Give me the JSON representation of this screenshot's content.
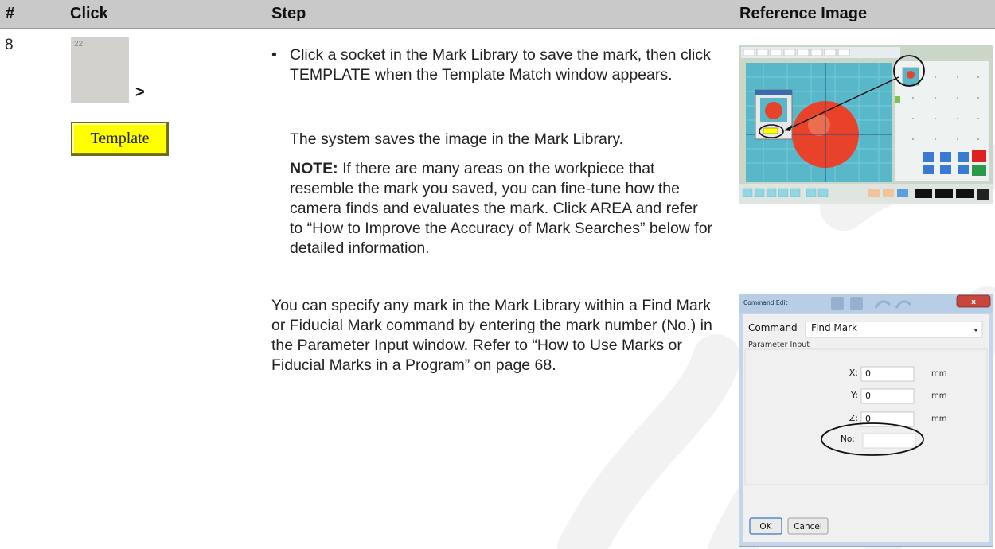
{
  "header": {
    "col_num": "#",
    "col_click": "Click",
    "col_step": "Step",
    "col_ref": "Reference Image"
  },
  "row1": {
    "number": "8",
    "socket_label": "22",
    "arrow": ">",
    "template_button": "Template",
    "bullet": "•",
    "bullet_text": "Click a socket in the Mark Library to save the mark, then click TEMPLATE when the Template Match window appears.",
    "para": "The system saves the image in the Mark Library.",
    "note_label": "NOTE:",
    "note_text": " If there are many areas on the workpiece that resemble the mark you saved, you can fine-tune how the camera finds and evaluates the mark. Click AREA and refer to “How to Improve the Accuracy of Mark Searches” below for detailed information."
  },
  "row2": {
    "para": "You can specify any mark in the Mark Library within a Find Mark or Fiducial Mark command by entering the mark number (No.) in the Parameter Input window. Refer to “How to Use Marks or Fiducial Marks in a Program” on page 68."
  },
  "dialog": {
    "title": "Command Edit",
    "command_label": "Command",
    "command_value": "Find Mark",
    "group_label": "Parameter Input",
    "x_label": "X:",
    "x_value": "0",
    "y_label": "Y:",
    "y_value": "0",
    "z_label": "Z:",
    "z_value": "0",
    "unit": "mm",
    "no_label": "No:",
    "no_value": "",
    "ok_label": "OK",
    "cancel_label": "Cancel",
    "close_glyph": "x"
  },
  "colors": {
    "header_bg": "#c9c9c9",
    "template_yellow": "#ffff00",
    "camera_cyan": "#55b8c8",
    "mark_red": "#e8432a"
  },
  "icons": {
    "watermark": "watermark-logo",
    "dropdown": "dropdown-arrow-icon",
    "close": "close-icon"
  }
}
